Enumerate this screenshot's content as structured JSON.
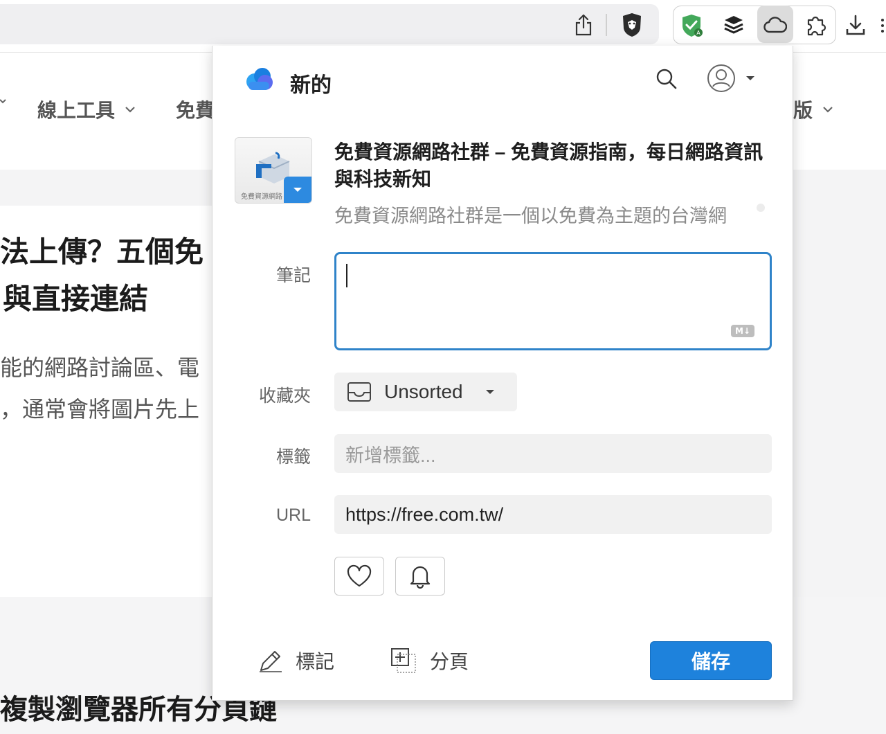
{
  "browser": {
    "toolbar_icons": [
      "share-icon",
      "brave-shield-icon",
      "extension-green-shield-icon",
      "extension-buffer-icon",
      "raindrop-cloud-icon",
      "extensions-puzzle-icon",
      "download-icon"
    ]
  },
  "page": {
    "nav": [
      {
        "label": "線上工具"
      },
      {
        "label": "免費"
      },
      {
        "label": "版"
      }
    ],
    "headline_line1": "法上傳？五個免",
    "headline_line2": "與直接連結",
    "para_line1": "能的網路討論區、電",
    "para_line2": "，通常會將圖片先上",
    "bottom_headline": "複製瀏覽器所有分頁鏈"
  },
  "popup": {
    "header_title": "新的",
    "bookmark": {
      "thumb_caption": "免費資源網路",
      "title": "免費資源網路社群 – 免費資源指南，每日網路資訊與科技新知",
      "description": "免費資源網路社群是一個以免費為主題的台灣網"
    },
    "labels": {
      "note": "筆記",
      "collection": "收藏夾",
      "tags": "標籤",
      "url": "URL"
    },
    "note_value": "",
    "md_badge": "M↓",
    "collection_value": "Unsorted",
    "tags_placeholder": "新增標籤...",
    "url_value": "https://free.com.tw/",
    "footer": {
      "highlight_label": "標記",
      "tabs_label": "分頁",
      "save_label": "儲存"
    }
  },
  "colors": {
    "accent": "#1e82dc",
    "focus_border": "#2f83c9"
  }
}
